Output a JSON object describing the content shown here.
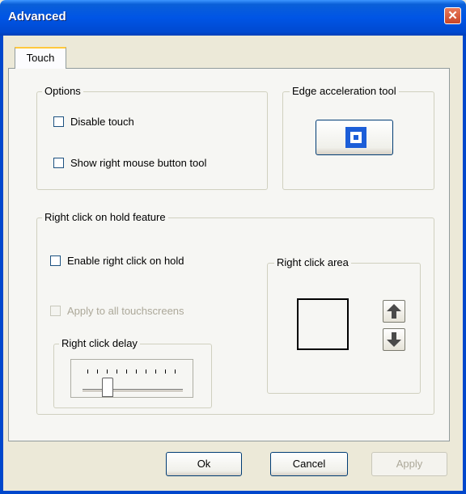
{
  "window": {
    "title": "Advanced",
    "close_glyph": "✕"
  },
  "tabs": [
    {
      "label": "Touch",
      "selected": true
    }
  ],
  "options": {
    "label": "Options",
    "disable_touch": "Disable touch",
    "show_right_mouse": "Show right mouse button tool"
  },
  "edge": {
    "label": "Edge acceleration tool",
    "icon": "edge-acceleration-icon"
  },
  "right_click_hold": {
    "label": "Right click on hold feature",
    "enable": "Enable right click on hold",
    "apply_all": "Apply to all touchscreens",
    "delay_label": "Right click delay",
    "delay_level": 0.25,
    "area_label": "Right click area",
    "up_icon": "arrow-up-icon",
    "down_icon": "arrow-down-icon"
  },
  "buttons": {
    "ok": "Ok",
    "cancel": "Cancel",
    "apply": "Apply"
  },
  "colors": {
    "titlebar": "#0055e5",
    "close": "#c94528",
    "accent": "#1c5ed8"
  }
}
